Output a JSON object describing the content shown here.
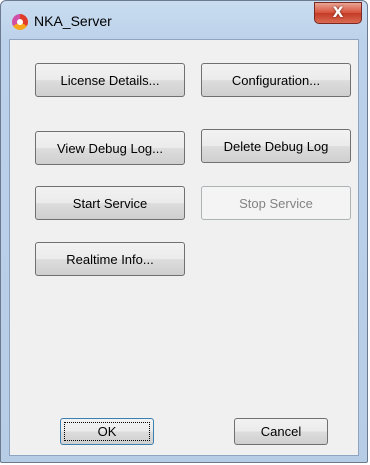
{
  "window": {
    "title": "NKA_Server",
    "close_glyph": "X"
  },
  "buttons": {
    "license_details": "License Details...",
    "configuration": "Configuration...",
    "view_debug_log": "View Debug Log...",
    "delete_debug_log": "Delete Debug Log",
    "start_service": "Start Service",
    "stop_service": "Stop Service",
    "realtime_info": "Realtime Info...",
    "ok": "OK",
    "cancel": "Cancel"
  },
  "states": {
    "stop_service_enabled": false,
    "ok_is_default": true
  },
  "icons": {
    "app": "nka-server-app-icon",
    "close": "close-icon"
  },
  "colors": {
    "frame": "#bcd2ea",
    "close_button": "#c43a25",
    "dialog_background": "#f0f0f0",
    "disabled_text": "#838383"
  }
}
